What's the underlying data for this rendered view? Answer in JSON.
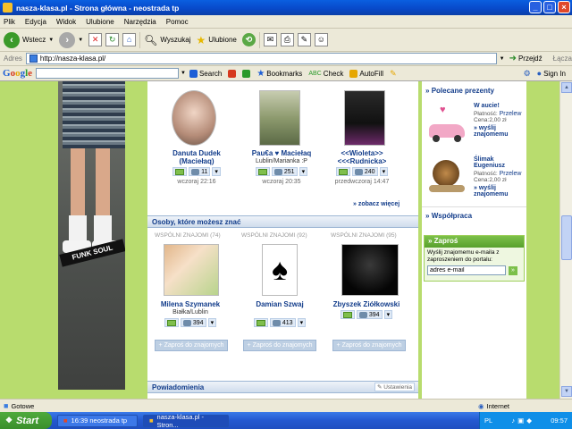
{
  "window": {
    "title": "nasza-klasa.pl - Strona główna - neostrada tp"
  },
  "menu": [
    "Plik",
    "Edycja",
    "Widok",
    "Ulubione",
    "Narzędzia",
    "Pomoc"
  ],
  "toolbar": {
    "back_label": "Wstecz",
    "search_label": "Wyszukaj",
    "favorites_label": "Ulubione"
  },
  "address": {
    "label": "Adres",
    "url": "http://nasza-klasa.pl/",
    "go_label": "Przejdź",
    "links_label": "Łącza"
  },
  "google_toolbar": {
    "logo": "Google",
    "search_label": "Search",
    "bookmarks_label": "Bookmarks",
    "check_label": "Check",
    "autofill_label": "AutoFill",
    "signin_label": "Sign In"
  },
  "friends": [
    {
      "name": "Danuta Dudek (Maciełaq)",
      "sub": "",
      "count": "11",
      "when": "wczoraj 22:16"
    },
    {
      "name": "Pau€a ♥ Maciełaq",
      "sub": "Lublin/Marianka :P",
      "count": "251",
      "when": "wczoraj 20:35"
    },
    {
      "name": "<<Wioleta>> <<<Rudnicka>",
      "sub": "",
      "count": "240",
      "when": "przedwczoraj 14:47"
    }
  ],
  "see_more": "zobacz więcej",
  "people_section": {
    "title": "Osoby, które możesz znać",
    "common_label": "WSPÓLNI ZNAJOMI",
    "add_label": "Zaproś do znajomych",
    "people": [
      {
        "common": "(74)",
        "name": "Milena Szymanek",
        "sub": "Białka/Lublin",
        "count": "394"
      },
      {
        "common": "(92)",
        "name": "Damian Szwaj",
        "sub": "",
        "count": "413"
      },
      {
        "common": "(95)",
        "name": "Zbyszek Ziółkowski",
        "sub": "",
        "count": "394"
      }
    ]
  },
  "notifications": {
    "title": "Powiadomienia",
    "settings_label": "Ustawienia"
  },
  "gifts": {
    "title": "Polecane prezenty",
    "items": [
      {
        "name": "W aucie!",
        "payment_label": "Płatność:",
        "payment": "Przelew",
        "price_label": "Cena:",
        "price": "2,00 zł",
        "send": "wyślij znajomemu"
      },
      {
        "name": "Ślimak Eugeniusz",
        "payment_label": "Płatność:",
        "payment": "Przelew",
        "price_label": "Cena:",
        "price": "2,00 zł",
        "send": "wyślij znajomemu"
      }
    ]
  },
  "cooperation": {
    "title": "Współpraca"
  },
  "invite": {
    "title": "Zaproś",
    "text": "Wyślij znajomemu e-maila z zaproszeniem do portalu:",
    "placeholder": "adres e-mail"
  },
  "photo_logo": "FUNK SOUL",
  "statusbar": {
    "left": "Gotowe",
    "zone": "Internet"
  },
  "taskbar": {
    "start": "Start",
    "tasks": [
      "16:39 neostrada tp",
      "nasza-klasa.pl - Stron..."
    ],
    "lang": "PL",
    "time": "09:57"
  },
  "colors": {
    "page_bg": "#b8dc6e",
    "link": "#123c8a",
    "header_blue": "#cfdcec"
  }
}
